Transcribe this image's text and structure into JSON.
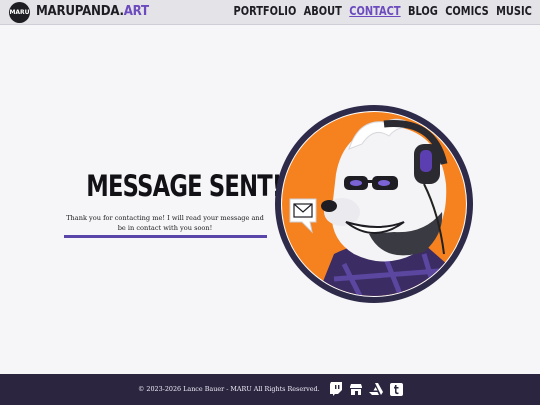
{
  "header": {
    "logo_badge": "MARU",
    "brand_main": "MARUPANDA.",
    "brand_accent": "ART",
    "nav": [
      {
        "label": "PORTFOLIO",
        "active": false
      },
      {
        "label": "ABOUT",
        "active": false
      },
      {
        "label": "CONTACT",
        "active": true
      },
      {
        "label": "BLOG",
        "active": false
      },
      {
        "label": "COMICS",
        "active": false
      },
      {
        "label": "MUSIC",
        "active": false
      }
    ]
  },
  "main": {
    "title": "MESSAGE SENT!",
    "message": "Thank you for contacting me! I will read your message and be in contact with you soon!",
    "avatar_icon": "panda-avatar-illustration"
  },
  "footer": {
    "copyright": "© 2023-2026 Lance Bauer - MARU All Rights Reserved.",
    "social_icons": [
      "twitch-icon",
      "storefront-icon",
      "artstation-icon",
      "tumblr-icon"
    ]
  },
  "colors": {
    "accent": "#6b4bbd",
    "footer_bg": "#2b2540",
    "avatar_bg": "#f5821f",
    "avatar_ring": "#2e2a4a"
  }
}
